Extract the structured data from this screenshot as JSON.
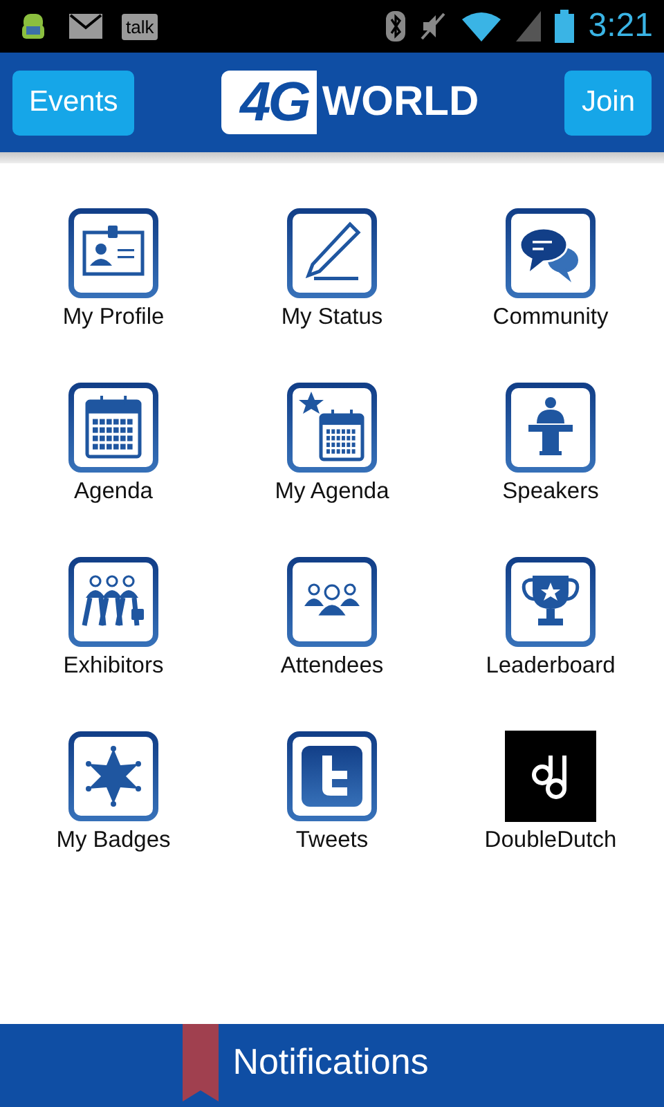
{
  "status_bar": {
    "talk_label": "talk",
    "time": "3:21"
  },
  "app_bar": {
    "left_button": "Events",
    "logo": {
      "mark": "4G",
      "word": "WORLD"
    },
    "right_button": "Join"
  },
  "tiles": [
    {
      "kind": "profile",
      "label": "My Profile"
    },
    {
      "kind": "status",
      "label": "My Status"
    },
    {
      "kind": "community",
      "label": "Community"
    },
    {
      "kind": "agenda",
      "label": "Agenda"
    },
    {
      "kind": "my-agenda",
      "label": "My Agenda"
    },
    {
      "kind": "speakers",
      "label": "Speakers"
    },
    {
      "kind": "exhibitors",
      "label": "Exhibitors"
    },
    {
      "kind": "attendees",
      "label": "Attendees"
    },
    {
      "kind": "leaderboard",
      "label": "Leaderboard"
    },
    {
      "kind": "badges",
      "label": "My Badges"
    },
    {
      "kind": "tweets",
      "label": "Tweets"
    },
    {
      "kind": "doubledutch",
      "label": "DoubleDutch"
    }
  ],
  "bottom_bar": {
    "label": "Notifications"
  }
}
